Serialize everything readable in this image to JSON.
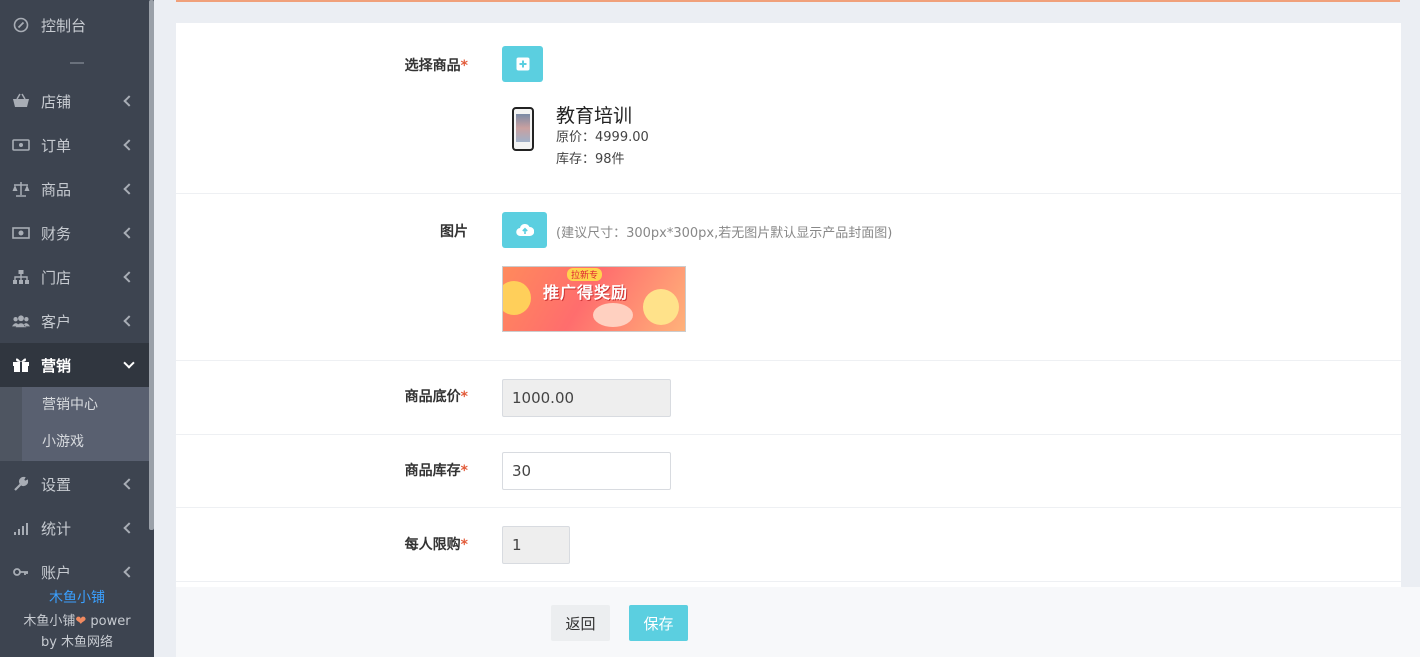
{
  "sidebar": {
    "items": [
      {
        "key": "dashboard",
        "label": "控制台",
        "icon": "dashboard-icon"
      },
      {
        "key": "shop",
        "label": "店铺",
        "icon": "basket-icon"
      },
      {
        "key": "order",
        "label": "订单",
        "icon": "ticket-icon"
      },
      {
        "key": "goods",
        "label": "商品",
        "icon": "scale-icon"
      },
      {
        "key": "finance",
        "label": "财务",
        "icon": "money-icon"
      },
      {
        "key": "store",
        "label": "门店",
        "icon": "sitemap-icon"
      },
      {
        "key": "customer",
        "label": "客户",
        "icon": "users-icon"
      },
      {
        "key": "marketing",
        "label": "营销",
        "icon": "gift-icon"
      },
      {
        "key": "settings",
        "label": "设置",
        "icon": "wrench-icon"
      },
      {
        "key": "stats",
        "label": "统计",
        "icon": "signal-icon"
      },
      {
        "key": "account",
        "label": "账户",
        "icon": "key-icon"
      }
    ],
    "submenu": [
      "营销中心",
      "小游戏"
    ],
    "footer": {
      "brand": "木鱼小铺",
      "power_prefix": "木鱼小铺",
      "heart": "❤",
      "power_suffix": " power",
      "by": "by 木鱼网络"
    }
  },
  "form": {
    "select_goods_label": "选择商品",
    "required_mark": "*",
    "product": {
      "name": "教育培训",
      "original_price": "原价：4999.00",
      "stock": "库存：98件"
    },
    "image_label": "图片",
    "image_hint": "(建议尺寸：300px*300px,若无图片默认显示产品封面图)",
    "banner_title": "推广得奖励",
    "banner_tag": "拉新专",
    "base_price_label": "商品底价",
    "base_price_value": "1000.00",
    "stock_label": "商品库存",
    "stock_value": "30",
    "limit_label": "每人限购",
    "limit_value": "1"
  },
  "actions": {
    "back": "返回",
    "save": "保存"
  },
  "colors": {
    "accent": "#5bcfe0",
    "sidebar_bg": "#3d4450",
    "required": "#e25b3a",
    "brand_link": "#3aa0ff"
  }
}
